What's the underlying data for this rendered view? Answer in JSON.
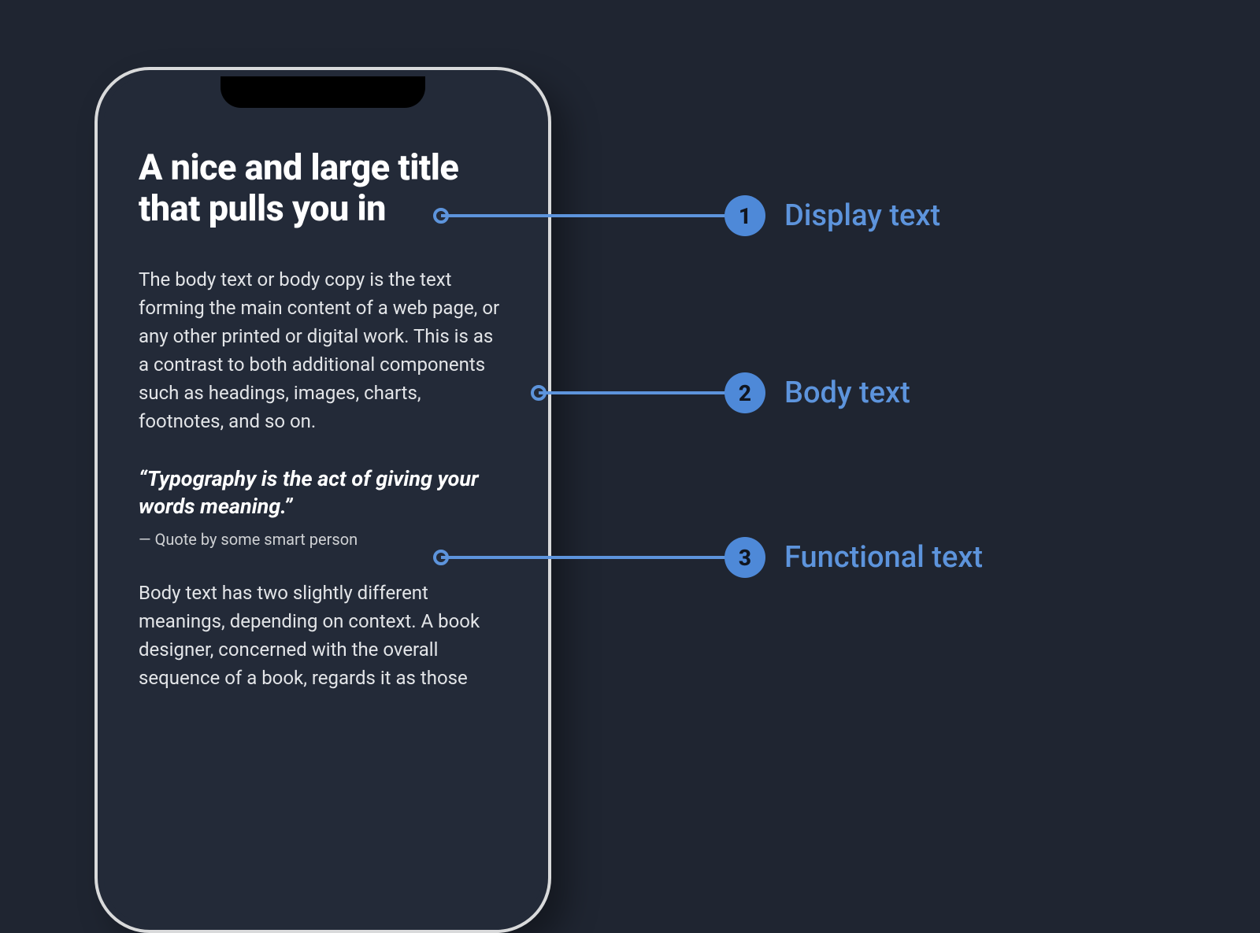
{
  "phone": {
    "title": "A nice and large title that pulls you in",
    "body1": "The body text or body copy is the text forming the main content of a web page, or any other printed or digital work. This is as a contrast to both additional components such as headings, images, charts, footnotes, and so on.",
    "quote": "“Typography is the act of giving your words meaning.”",
    "attribution": "— Quote by some smart person",
    "body2": "Body text has two slightly different meanings, depending on context. A book designer, concerned with the overall sequence of a book, regards it as those"
  },
  "callouts": [
    {
      "num": "1",
      "label": "Display text"
    },
    {
      "num": "2",
      "label": "Body text"
    },
    {
      "num": "3",
      "label": "Functional text"
    }
  ],
  "colors": {
    "accent": "#5d94dc",
    "badge": "#4e89d8",
    "bg": "#1f2531",
    "screen": "#232a38"
  }
}
